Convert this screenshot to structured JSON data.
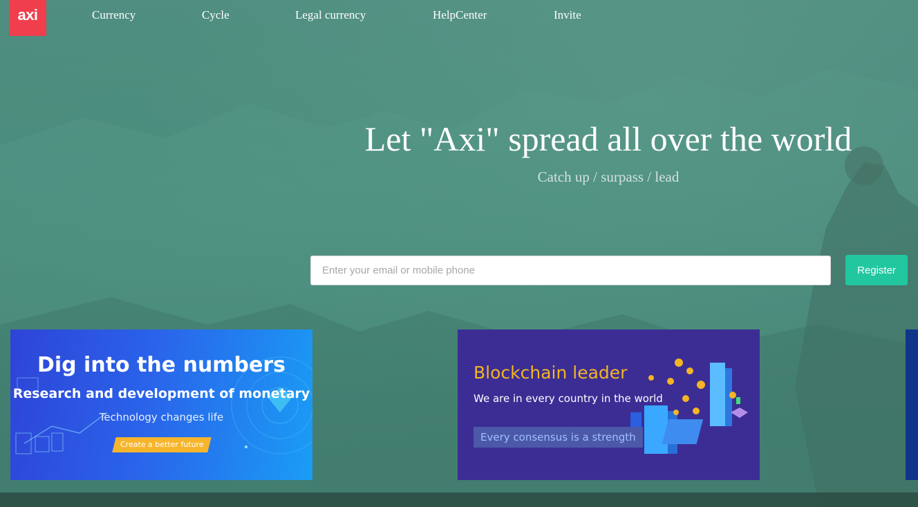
{
  "brand": {
    "logo_text": "axi",
    "logo_color": "#f03e4d"
  },
  "nav": {
    "items": [
      {
        "label": "Currency"
      },
      {
        "label": "Cycle"
      },
      {
        "label": "Legal currency"
      },
      {
        "label": "HelpCenter"
      },
      {
        "label": "Invite"
      }
    ]
  },
  "hero": {
    "title": "Let \"Axi\" spread all over the world",
    "subtitle": "Catch up / surpass / lead"
  },
  "signup": {
    "placeholder": "Enter your email or mobile phone",
    "value": "",
    "register_label": "Register",
    "accent": "#22c7a0"
  },
  "banners": [
    {
      "title": "Dig into the numbers",
      "subtitle": "Research and development of monetary",
      "tagline": "Technology changes life",
      "cta": "Create a better future"
    },
    {
      "title": "Blockchain leader",
      "subtitle": "We are in every country in the world",
      "tagline": "Every consensus is a strength"
    }
  ]
}
